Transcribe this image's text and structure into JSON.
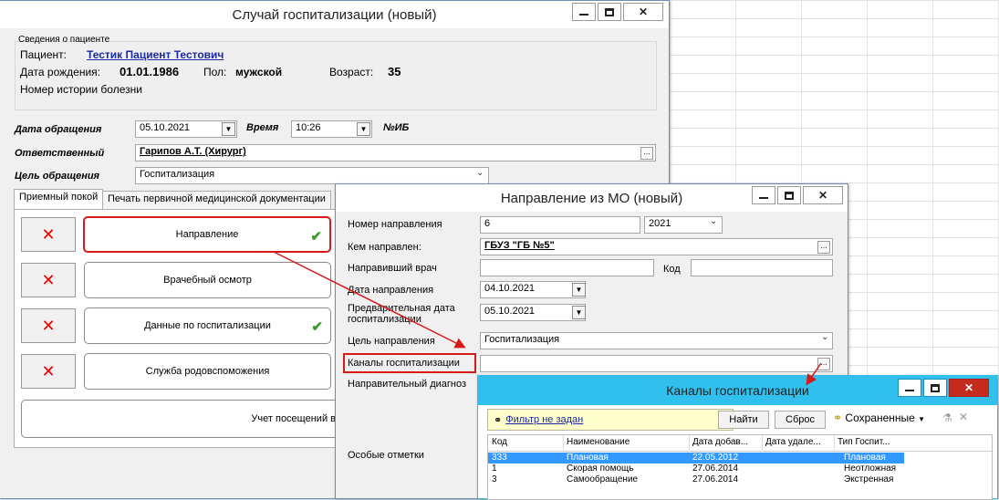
{
  "windows": {
    "hosp": {
      "title": "Случай госпитализации (новый)",
      "patient": {
        "section_title": "Сведения о пациенте",
        "label_patient": "Пациент:",
        "name": "Тестик Пациент Тестович",
        "label_birth": "Дата рождения:",
        "birth_date": "01.01.1986",
        "label_sex": "Пол:",
        "sex": "мужской",
        "label_age": "Возраст:",
        "age": "35",
        "history_label": "Номер истории болезни"
      },
      "form": {
        "visit_date_label": "Дата обращения",
        "visit_date": "05.10.2021",
        "time_label": "Время",
        "time": "10:26",
        "ib_label": "№ИБ",
        "responsible_label": "Ответственный",
        "responsible": "Гарипов А.Т. (Хирург)",
        "purpose_label": "Цель обращения",
        "purpose": "Госпитализация"
      },
      "tabs": [
        "Приемный покой",
        "Печать первичной медицинской документации"
      ],
      "actions": [
        {
          "label": "Направление",
          "checked": true
        },
        {
          "label": "Врачебный осмотр",
          "checked": false
        },
        {
          "label": "Данные по госпитализации",
          "checked": true
        },
        {
          "label": "Служба родовспоможения",
          "checked": false
        }
      ],
      "visits_label": "Учет посещений в"
    },
    "referral": {
      "title": "Направление из МО (новый)",
      "number_label": "Номер направления",
      "number": "6",
      "year": "2021",
      "from_label": "Кем направлен:",
      "from": "ГБУЗ \"ГБ №5\"",
      "doctor_label": "Направивший врач",
      "doctor": "",
      "code_label": "Код",
      "code": "",
      "date_label": "Дата направления",
      "date": "04.10.2021",
      "prelim_label_1": "Предварительная дата",
      "prelim_label_2": "госпитализации",
      "prelim_date": "05.10.2021",
      "purpose_label": "Цель направления",
      "purpose": "Госпитализация",
      "channels_label": "Каналы госпитализации",
      "channels": "",
      "diag_label": "Направительный диагноз",
      "notes_label": "Особые отметки"
    },
    "channels": {
      "title": "Каналы госпитализации",
      "filter_label": "Фильтр не задан",
      "find_label": "Найти",
      "reset_label": "Сброс",
      "saved_label": "Сохраненные",
      "columns": [
        "Код",
        "Наименование",
        "Дата добав...",
        "Дата удале...",
        "Тип Госпит..."
      ],
      "rows": [
        {
          "code": "333",
          "name": "Плановая",
          "added": "22.05.2012",
          "deleted": "",
          "type": "Плановая",
          "selected": true
        },
        {
          "code": "1",
          "name": "Скорая помощь",
          "added": "27.06.2014",
          "deleted": "",
          "type": "Неотложная",
          "selected": false
        },
        {
          "code": "3",
          "name": "Самообращение",
          "added": "27.06.2014",
          "deleted": "",
          "type": "Экстренная",
          "selected": false
        }
      ]
    }
  },
  "colors": {
    "highlight": "#d61a1a",
    "selection": "#3399ff",
    "filter_bg": "#ffffcc",
    "channels_titlebar": "#31c0ee"
  },
  "icons": {
    "x": "✕",
    "check": "✔",
    "chevron": "⌄",
    "ellipsis": "...",
    "binoculars": "🔭"
  }
}
